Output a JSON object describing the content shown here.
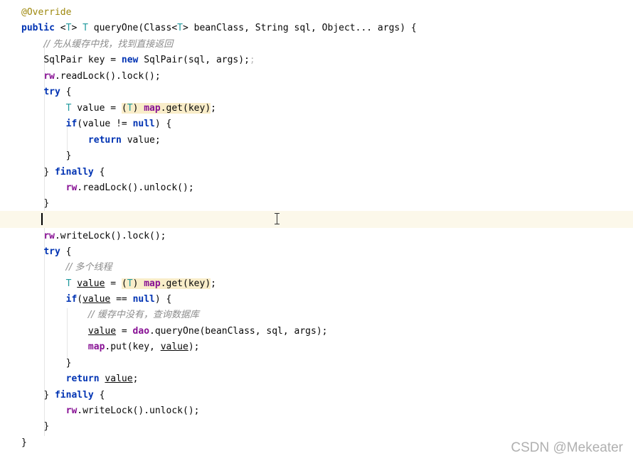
{
  "watermark": "CSDN @Mekeater",
  "code": {
    "l1": {
      "ann": "@Override"
    },
    "l2": {
      "kw": "public",
      "a": " <",
      "t1": "T",
      "b": "> ",
      "t2": "T",
      "c": " queryOne(Class<",
      "t3": "T",
      "d": "> beanClass, String sql, Object... args) {"
    },
    "l3": {
      "cmt": "// 先从缓存中找，找到直接返回"
    },
    "l4": {
      "a": "SqlPair key = ",
      "kw": "new",
      "b": " SqlPair(sql, args);",
      "dim": ";"
    },
    "l5": {
      "fld": "rw",
      "a": ".readLock().lock();"
    },
    "l6": {
      "kw": "try",
      "a": " {"
    },
    "l7": {
      "t": "T",
      "a": " value = ",
      "h1": "(",
      "ht": "T",
      "h2": ") ",
      "fld": "map",
      "h3": ".get(key)",
      "b": ";"
    },
    "l8": {
      "kw": "if",
      "a": "(value != ",
      "kw2": "null",
      "b": ") {"
    },
    "l9": {
      "kw": "return",
      "a": " value;"
    },
    "l10": {
      "a": "}"
    },
    "l11": {
      "a": "} ",
      "kw": "finally",
      "b": " {"
    },
    "l12": {
      "fld": "rw",
      "a": ".readLock().unlock();"
    },
    "l13": {
      "a": "}"
    },
    "l15": {
      "fld": "rw",
      "a": ".writeLock().lock();"
    },
    "l16": {
      "kw": "try",
      "a": " {"
    },
    "l17": {
      "cmt": "// 多个线程"
    },
    "l18": {
      "t": "T",
      "sp": " ",
      "u": "value",
      "a": " = ",
      "h1": "(",
      "ht": "T",
      "h2": ") ",
      "fld": "map",
      "h3": ".get(key)",
      "b": ";"
    },
    "l19": {
      "kw": "if",
      "a": "(",
      "u": "value",
      "b": " == ",
      "kw2": "null",
      "c": ") {"
    },
    "l20": {
      "cmt": "// 缓存中没有，查询数据库"
    },
    "l21": {
      "u": "value",
      "a": " = ",
      "fld": "dao",
      "b": ".queryOne(beanClass, sql, args);"
    },
    "l22": {
      "fld": "map",
      "a": ".put(key, ",
      "u": "value",
      "b": ");"
    },
    "l23": {
      "a": "}"
    },
    "l24": {
      "kw": "return",
      "sp": " ",
      "u": "value",
      "a": ";"
    },
    "l25": {
      "a": "} ",
      "kw": "finally",
      "b": " {"
    },
    "l26": {
      "fld": "rw",
      "a": ".writeLock().unlock();"
    },
    "l27": {
      "a": "}"
    },
    "l28": {
      "a": "}"
    }
  }
}
